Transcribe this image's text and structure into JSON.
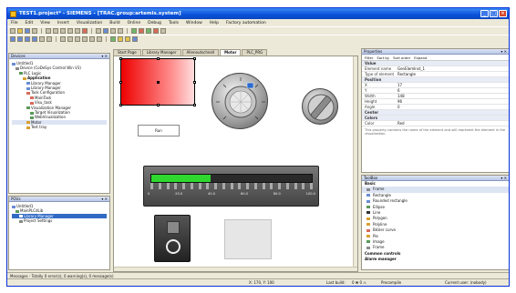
{
  "window": {
    "title": "TEST1.project* - SIEMENS - [TRAC.group:artemis.system]"
  },
  "menu": [
    "File",
    "Edit",
    "View",
    "Insert",
    "Visualization",
    "Build",
    "Online",
    "Debug",
    "Tools",
    "Window",
    "Help",
    "Factory automation"
  ],
  "devices_pane": {
    "title": "Devices",
    "tree": [
      "Untitled1",
      "Device (CoDeSys Control Win V3)",
      "PLC Logic",
      "Application",
      "Library Manager",
      "Library Manager",
      "Task Configuration",
      "MainTask",
      "Visu_task",
      "Visualization Manager",
      "Target Visualization",
      "WebVisualization",
      "Motor",
      "Test tray"
    ]
  },
  "pous_pane": {
    "title": "POUs",
    "tree": [
      "Untitled1",
      "MainPLCdLib",
      "Library Manager",
      "Project Settings"
    ]
  },
  "editor_tabs": [
    "Start Page",
    "Library Manager",
    "Alleneutschnell",
    "Motor",
    "PLC_PRG"
  ],
  "visualization": {
    "button_label": "Run",
    "bar_labels": [
      "0",
      "20.0",
      "40.0",
      "60.0",
      "80.0",
      "100.0"
    ],
    "bar_value_fraction": 0.37
  },
  "properties_pane": {
    "title": "Properties",
    "toolbar_items": [
      "Filter",
      "Sort by",
      "Sort order",
      "Expand"
    ],
    "rows": [
      {
        "k": "Value",
        "v": "",
        "section": true
      },
      {
        "k": "Element name",
        "v": "GenElemInst_1"
      },
      {
        "k": "Type of element",
        "v": "Rectangle"
      },
      {
        "k": "Position",
        "v": "",
        "section": true
      },
      {
        "k": "X",
        "v": "17"
      },
      {
        "k": "Y",
        "v": "6"
      },
      {
        "k": "Width",
        "v": "148"
      },
      {
        "k": "Height",
        "v": "96"
      },
      {
        "k": "Angle",
        "v": "0"
      },
      {
        "k": "Center",
        "v": "",
        "section": true
      },
      {
        "k": "Colors",
        "v": "",
        "section": true
      },
      {
        "k": "Color",
        "v": "Red"
      }
    ],
    "description": "This property contains the name of the element and will represent the element in the visualization."
  },
  "toolbox_pane": {
    "title": "ToolBox",
    "category": "Basic",
    "tools": [
      "Frame",
      "Rectangle",
      "Rounded rectangle",
      "Ellipse",
      "Line",
      "Polygon",
      "Polyline",
      "Bézier curve",
      "Pie",
      "Image",
      "Frame"
    ],
    "more_categories": [
      "Common controls",
      "Alarm manager"
    ]
  },
  "messages": {
    "label": "Messages - Totally 0 error(s), 0 warning(s), 0 message(s)"
  },
  "statusbar": {
    "coords": "X: 170, Y: 100",
    "last_build": "Last build:",
    "build_counts": "0 ✖  0 ⚠",
    "precompile": "Precompile",
    "user": "Current user: (nobody)"
  },
  "colors": {
    "accent": "#0a51d9",
    "title_bar": "#3b8af5",
    "bar_fill": "#2ed82e",
    "rect_fill": "#ee0000"
  }
}
